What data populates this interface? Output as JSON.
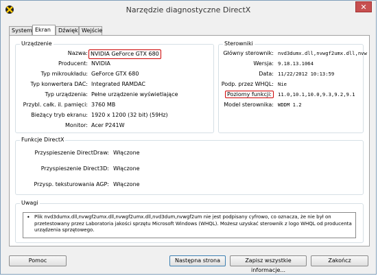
{
  "window": {
    "title": "Narzędzie diagnostyczne DirectX",
    "close_symbol": "✕"
  },
  "tabs": [
    {
      "label": "System"
    },
    {
      "label": "Ekran"
    },
    {
      "label": "Dźwięk"
    },
    {
      "label": "Wejście"
    }
  ],
  "device": {
    "title": "Urządzenie",
    "rows": [
      {
        "label": "Nazwa:",
        "value": "NVIDIA GeForce GTX 680"
      },
      {
        "label": "Producent:",
        "value": "NVIDIA"
      },
      {
        "label": "Typ mikroukładu:",
        "value": "GeForce GTX 680"
      },
      {
        "label": "Typ konwertera DAC:",
        "value": "Integrated RAMDAC"
      },
      {
        "label": "Typ urządzenia:",
        "value": "Pełne urządzenie wyświetlające"
      },
      {
        "label": "Przybl. całk. il. pamięci:",
        "value": "3760 MB"
      },
      {
        "label": "Bieżący tryb ekranu:",
        "value": "1920 x 1200 (32 bit) (59Hz)"
      },
      {
        "label": "Monitor:",
        "value": "Acer P241W"
      }
    ]
  },
  "drivers": {
    "title": "Sterowniki",
    "rows": [
      {
        "label": "Główny sterownik:",
        "value": "nvd3dumx.dll,nvwgf2umx.dll,nvw"
      },
      {
        "label": "Wersja:",
        "value": "9.18.13.1064"
      },
      {
        "label": "Data:",
        "value": "11/22/2012 10:13:59"
      },
      {
        "label": "Podp. przez WHQL:",
        "value": "Nie"
      },
      {
        "label": "Poziomy funkcji:",
        "value": "11.0,10.1,10.0,9.3,9.2,9.1"
      },
      {
        "label": "Model sterownika:",
        "value": "WDDM 1.2"
      }
    ]
  },
  "features": {
    "title": "Funkcje DirectX",
    "rows": [
      {
        "label": "Przyspieszenie DirectDraw:",
        "value": "Włączone"
      },
      {
        "label": "Przyspieszenie Direct3D:",
        "value": "Włączone"
      },
      {
        "label": "Przysp. teksturowania AGP:",
        "value": "Włączone"
      }
    ]
  },
  "notes": {
    "title": "Uwagi",
    "bullet": "•",
    "text": "Plik nvd3dumx.dll,nvwgf2umx.dll,nvwgf2umx.dll,nvd3dum,nvwgf2um nie jest podpisany cyfrowo, co oznacza, że nie był on przetestowany przez Laboratoria jakości sprzętu Microsoft Windows (WHQL). Możesz uzyskać sterownik z logo WHQL od producenta urządzenia sprzętowego."
  },
  "buttons": {
    "help": "Pomoc",
    "next": "Następna strona",
    "save": "Zapisz wszystkie informacje...",
    "exit": "Zakończ"
  }
}
